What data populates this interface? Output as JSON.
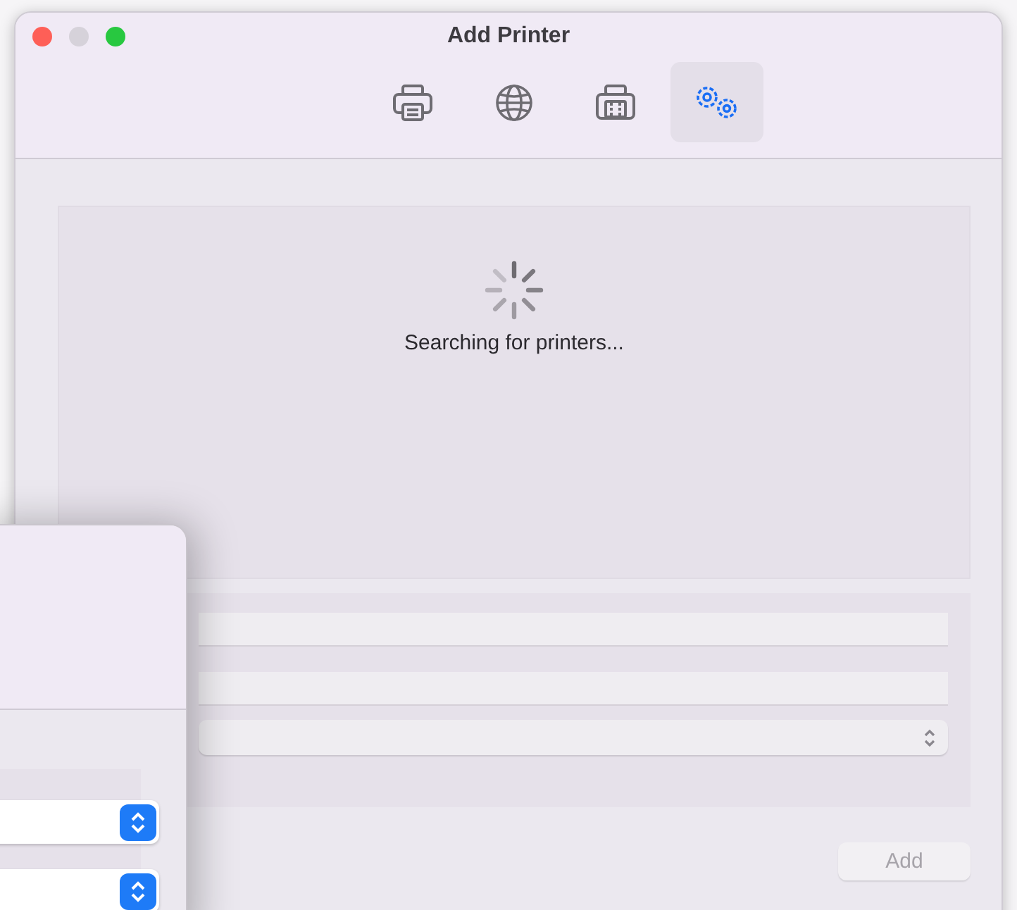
{
  "window": {
    "title": "Add Printer"
  },
  "window_buttons": [
    {
      "kind": "close",
      "disabled": false
    },
    {
      "kind": "minimize",
      "disabled": true
    },
    {
      "kind": "zoom",
      "disabled": false
    }
  ],
  "toolbar_tabs": [
    {
      "kind": "printer",
      "selected": false
    },
    {
      "kind": "globe",
      "selected": false
    },
    {
      "kind": "fax",
      "selected": false
    },
    {
      "kind": "advanced",
      "selected": true
    }
  ],
  "printer_list": {
    "status": "Searching for printers..."
  },
  "form": {
    "fields": [
      {
        "kind": "text"
      },
      {
        "kind": "text"
      },
      {
        "kind": "popup"
      }
    ]
  },
  "add_button": {
    "label": "Add",
    "disabled": true
  },
  "background_window": {
    "popups": [
      {
        "kind": "popup"
      },
      {
        "kind": "popup"
      }
    ]
  }
}
